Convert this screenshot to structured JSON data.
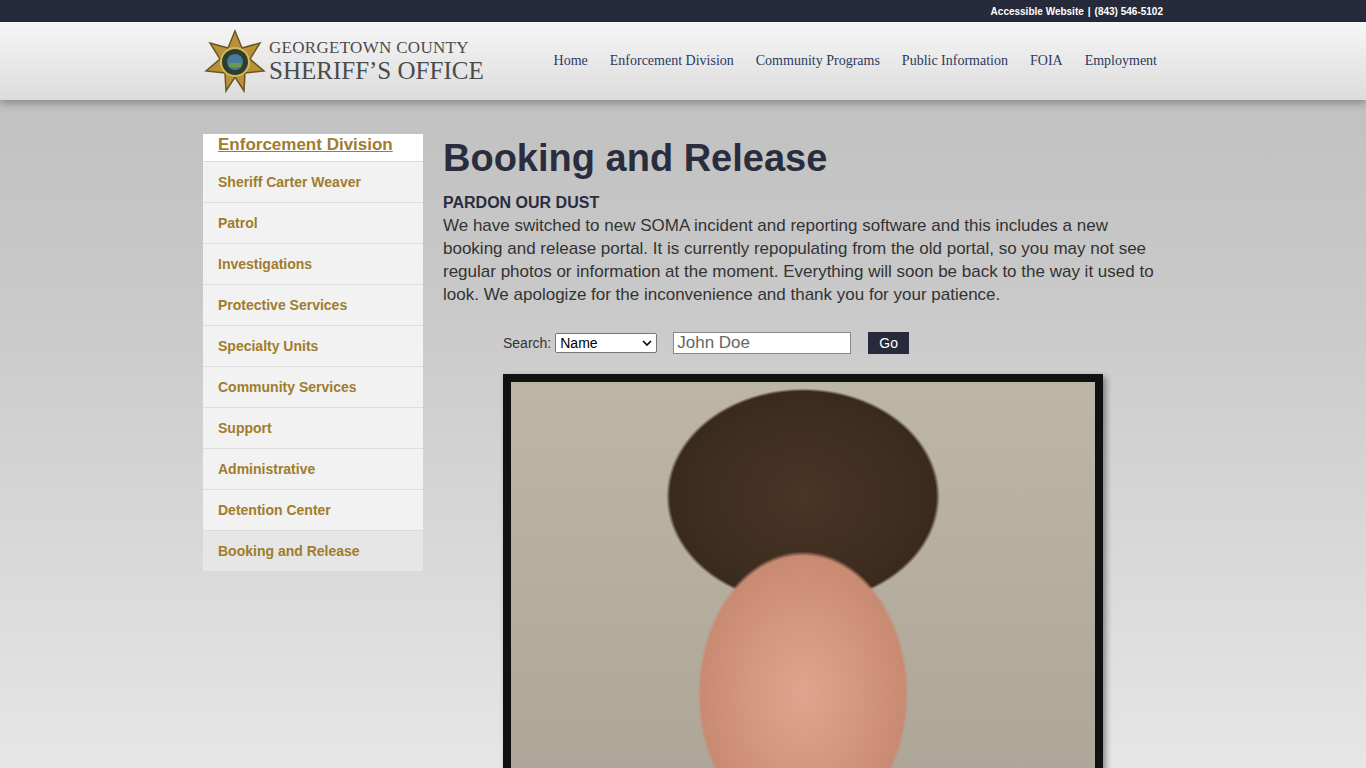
{
  "topbar": {
    "links": [
      "Accessible Website",
      "|",
      "(843) 546-5102"
    ]
  },
  "logo": {
    "line1": "GEORGETOWN COUNTY",
    "line2": "SHERIFF’S OFFICE"
  },
  "nav": [
    {
      "label": "Home"
    },
    {
      "label": "Enforcement Division"
    },
    {
      "label": "Community Programs"
    },
    {
      "label": "Public Information"
    },
    {
      "label": "FOIA"
    },
    {
      "label": "Employment"
    }
  ],
  "sidebar": {
    "title": "Enforcement Division",
    "items": [
      {
        "label": "Sheriff Carter Weaver",
        "selected": false
      },
      {
        "label": "Patrol",
        "selected": false
      },
      {
        "label": "Investigations",
        "selected": false
      },
      {
        "label": "Protective Services",
        "selected": false
      },
      {
        "label": "Specialty Units",
        "selected": false
      },
      {
        "label": "Community Services",
        "selected": false
      },
      {
        "label": "Support",
        "selected": false
      },
      {
        "label": "Administrative",
        "selected": false
      },
      {
        "label": "Detention Center",
        "selected": false
      },
      {
        "label": "Booking and Release",
        "selected": true
      }
    ]
  },
  "page": {
    "title": "Booking and Release",
    "notice_title": "PARDON OUR DUST",
    "notice": "We have switched to new SOMA incident and reporting software and this includes a new booking and release portal. It is currently repopulating from the old portal, so you may not see regular photos or information at the moment. Everything will soon be back to the way it used to look. We apologize for the inconvenience and thank you for your patience."
  },
  "search": {
    "label": "Search:",
    "select": "Name",
    "placeholder": "John Doe",
    "button": "Go"
  }
}
